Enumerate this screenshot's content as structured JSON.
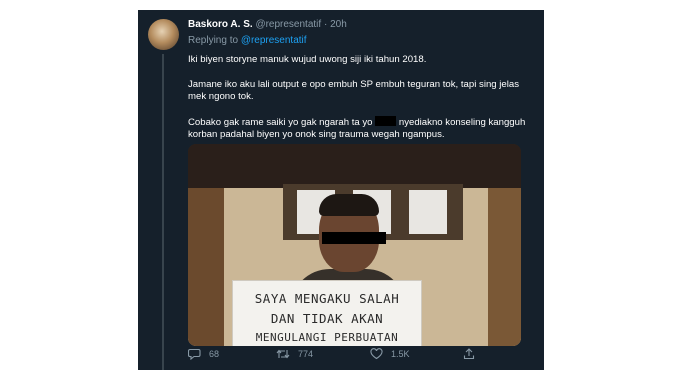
{
  "tweet": {
    "author_name": "Baskoro A. S.",
    "author_handle": "@representatif",
    "separator": "·",
    "time": "20h",
    "replying_label": "Replying to",
    "replying_to": "@representatif",
    "paragraph_1": "Iki biyen storyne manuk wujud uwong siji iki tahun 2018.",
    "paragraph_2": "Jamane iko aku lali output e opo embuh SP embuh teguran tok, tapi sing jelas mek ngono tok.",
    "paragraph_3_before": "Cobako gak rame saiki yo gak ngarah ta yo",
    "paragraph_3_after": "nyediakno konseling kangguh korban padahal biyen yo onok sing trauma wegah ngampus."
  },
  "media": {
    "sign_line_1": "SAYA MENGAKU SALAH",
    "sign_line_2": "DAN TIDAK AKAN",
    "sign_line_3": "MENGULANGI PERBUATAN"
  },
  "actions": {
    "replies": "68",
    "retweets": "774",
    "likes": "1.5K"
  },
  "icons": {
    "reply": "comment-bubble-icon",
    "retweet": "retweet-icon",
    "like": "heart-icon",
    "share": "share-icon"
  },
  "colors": {
    "background": "#15202b",
    "accent": "#1da1f2",
    "muted": "#8899a6",
    "text": "#ffffff"
  }
}
